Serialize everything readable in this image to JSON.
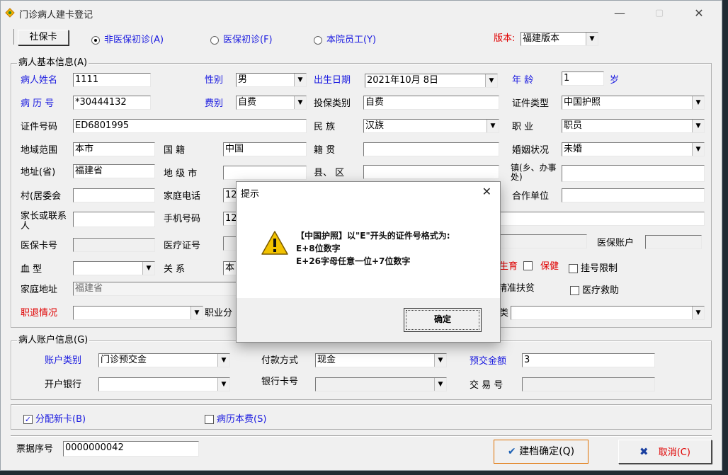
{
  "window": {
    "title": "门诊病人建卡登记",
    "minimize": "—",
    "maximize": "▢",
    "close": "✕"
  },
  "toolbar": {
    "social_card_button": "社保卡",
    "radio_non_insured": "非医保初诊(A)",
    "radio_insured": "医保初诊(F)",
    "radio_staff": "本院员工(Y)",
    "version_label": "版本:",
    "version_value": "福建版本"
  },
  "basic": {
    "group_title": "病人基本信息(A)",
    "name_label": "病人姓名",
    "name_value": "1111",
    "sex_label": "性别",
    "sex_value": "男",
    "birth_label": "出生日期",
    "birth_value": "2021年10月 8日",
    "age_label": "年   龄",
    "age_value": "1",
    "age_unit": "岁",
    "record_label": "病 历 号",
    "record_value": "*30444132",
    "fee_label": "费别",
    "fee_value": "自费",
    "ins_type_label": "投保类别",
    "ins_type_value": "自费",
    "cert_type_label": "证件类型",
    "cert_type_value": "中国护照",
    "cert_no_label": "证件号码",
    "cert_no_value": "ED6801995",
    "ethnic_label": "民   族",
    "ethnic_value": "汉族",
    "job_label": "职   业",
    "job_value": "职员",
    "region_label": "地域范围",
    "region_value": "本市",
    "nation_label": "国   籍",
    "nation_value": "中国",
    "native_label": "籍   贯",
    "native_value": "",
    "marital_label": "婚姻状况",
    "marital_value": "未婚",
    "province_label": "地址(省)",
    "province_value": "福建省",
    "city_label": "地 级 市",
    "city_value": "",
    "county_label": "县、 区",
    "county_value": "",
    "town_label": "镇(乡、办事处)",
    "town_value": "",
    "village_label": "村(居委会",
    "village_value": "",
    "home_phone_label": "家庭电话",
    "home_phone_value": "12",
    "company_label": "合作单位",
    "company_value": "",
    "guardian_label": "家长或联系人",
    "guardian_value": "",
    "mobile_label": "手机号码",
    "mobile_value": "12",
    "insure_card_label": "医保卡号",
    "insure_card_value": "",
    "med_cert_label": "医疗证号",
    "med_cert_value": "",
    "insure_account_label": "医保账户",
    "insure_account_value": "",
    "blood_label": "血   型",
    "blood_value": "",
    "relation_label": "关   系",
    "relation_value": "本",
    "birth_check_label": "生育",
    "care_check_label": "保健",
    "reg_limit_label": "挂号限制",
    "home_addr_label": "家庭地址",
    "home_addr_value": "福建省",
    "poverty_label": "精准扶贫",
    "med_aid_label": "医疗救助",
    "retire_label": "职退情况",
    "retire_value": "",
    "occ_class_label": "职业分",
    "class_label": "类",
    "class_value": ""
  },
  "account": {
    "group_title": "病人账户信息(G)",
    "acct_type_label": "账户类别",
    "acct_type_value": "门诊预交金",
    "pay_method_label": "付款方式",
    "pay_method_value": "现金",
    "prepay_label": "预交金额",
    "prepay_value": "3",
    "bank_label": "开户银行",
    "bank_value": "",
    "bank_card_label": "银行卡号",
    "bank_card_value": "",
    "trade_no_label": "交 易 号",
    "trade_no_value": ""
  },
  "options": {
    "new_card_label": "分配新卡(B)",
    "record_fee_label": "病历本费(S)"
  },
  "footer": {
    "ticket_label": "票据序号",
    "ticket_value": "0000000042",
    "confirm_label": "建档确定(Q)",
    "cancel_label": "取消(C)"
  },
  "dialog": {
    "title": "提示",
    "close": "✕",
    "line1": "【中国护照】以\"E\"开头的证件号格式为:",
    "line2": "E+8位数字",
    "line3": "E+26字母任意一位+7位数字",
    "ok_label": "确定"
  }
}
